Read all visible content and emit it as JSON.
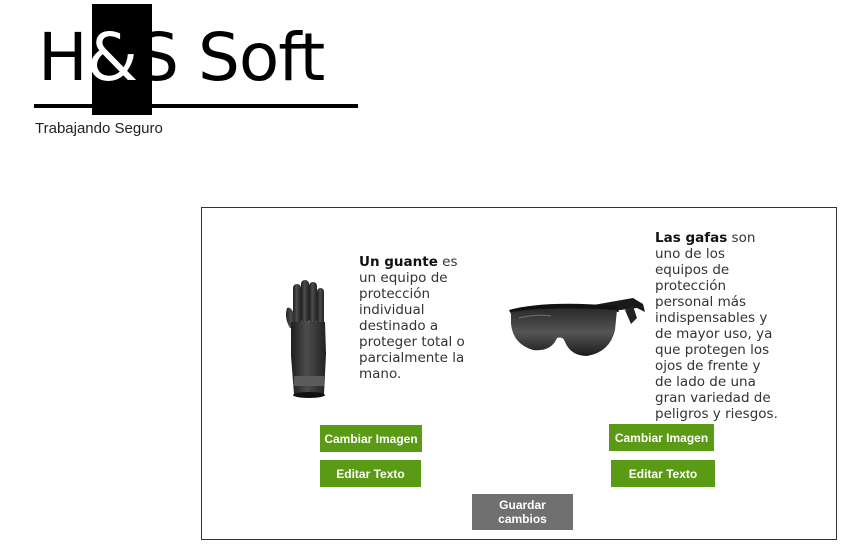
{
  "logo": {
    "brand_prefix": "H",
    "brand_amp": "&",
    "brand_suffix": "S Soft",
    "tagline": "Trabajando Seguro"
  },
  "products": [
    {
      "title_bold": "Un guante",
      "text": " es un equipo de protección individual destinado a proteger total o parcialmente la mano.",
      "image_icon": "glove-icon",
      "change_image_label": "Cambiar Imagen",
      "edit_text_label": "Editar Texto"
    },
    {
      "title_bold": "Las gafas",
      "text": " son uno de los equipos de protección personal más indispensables y de mayor uso, ya que protegen los ojos de frente y de lado de una gran variedad de peligros y riesgos.",
      "image_icon": "safety-glasses-icon",
      "change_image_label": "Cambiar Imagen",
      "edit_text_label": "Editar Texto"
    }
  ],
  "save_label": "Guardar cambios",
  "colors": {
    "button_green": "#5b9a14",
    "button_gray": "#707070",
    "border": "#333333"
  }
}
